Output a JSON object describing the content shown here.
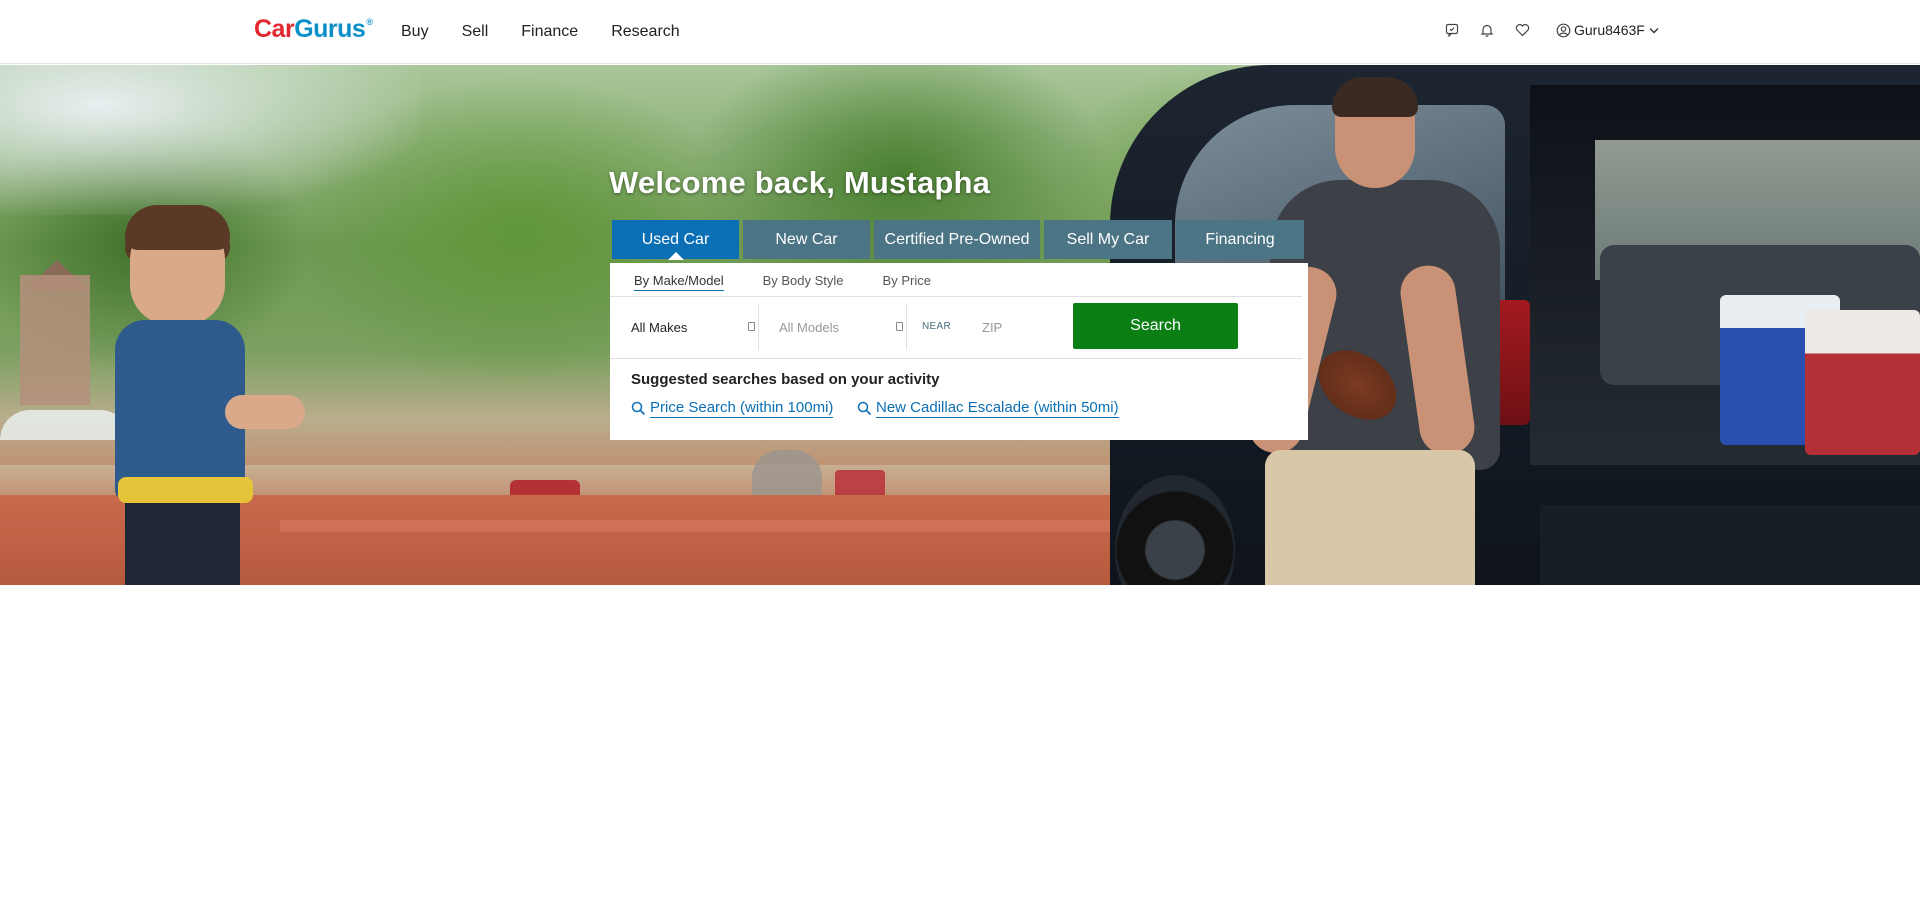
{
  "brand": {
    "car": "Car",
    "gurus": "Gurus",
    "reg": "®"
  },
  "nav": [
    "Buy",
    "Sell",
    "Finance",
    "Research"
  ],
  "header_icons": [
    "chat-icon",
    "bell-icon",
    "heart-icon",
    "user-icon"
  ],
  "user": {
    "name": "Guru8463F"
  },
  "hero": {
    "title": "Welcome back, Mustapha"
  },
  "tabs": [
    {
      "label": "Used Car",
      "active": true
    },
    {
      "label": "New Car",
      "active": false
    },
    {
      "label": "Certified Pre-Owned",
      "active": false
    },
    {
      "label": "Sell My Car",
      "active": false
    },
    {
      "label": "Financing",
      "active": false
    }
  ],
  "subtabs": [
    {
      "label": "By Make/Model",
      "active": true
    },
    {
      "label": "By Body Style",
      "active": false
    },
    {
      "label": "By Price",
      "active": false
    }
  ],
  "search": {
    "makes": "All Makes",
    "models": "All Models",
    "near": "NEAR",
    "zip_placeholder": "ZIP",
    "button": "Search"
  },
  "suggestions": {
    "title": "Suggested searches based on your activity",
    "items": [
      "Price Search (within 100mi)",
      "New Cadillac Escalade (within 50mi)"
    ]
  },
  "colors": {
    "brand_red": "#e1282f",
    "brand_blue": "#0a8fc9",
    "tab_active": "#0a6fb5",
    "tab_inactive": "#4b7484",
    "search_green": "#0b7f14",
    "link_blue": "#0a6fb5"
  }
}
